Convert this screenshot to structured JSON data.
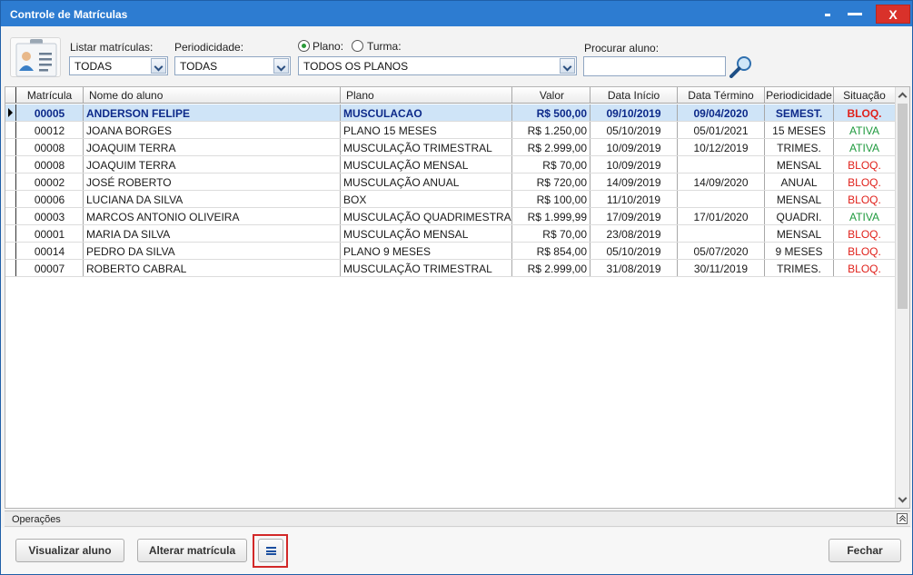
{
  "window": {
    "title": "Controle de Matrículas",
    "close_label": "X"
  },
  "filters": {
    "listar_label": "Listar matrículas:",
    "listar_value": "TODAS",
    "periodicidade_label": "Periodicidade:",
    "periodicidade_value": "TODAS",
    "radio_plano_label": "Plano:",
    "radio_turma_label": "Turma:",
    "radio_selected": "Plano",
    "plano_value": "TODOS OS PLANOS",
    "procurar_label": "Procurar aluno:",
    "procurar_value": ""
  },
  "grid": {
    "columns": [
      "Matrícula",
      "Nome do aluno",
      "Plano",
      "Valor",
      "Data Início",
      "Data Término",
      "Periodicidade",
      "Situação"
    ],
    "rows": [
      {
        "mat": "00005",
        "nome": "ANDERSON FELIPE",
        "plano": "MUSCULACAO",
        "valor": "R$ 500,00",
        "inicio": "09/10/2019",
        "termino": "09/04/2020",
        "per": "SEMEST.",
        "sit": "BLOQ."
      },
      {
        "mat": "00012",
        "nome": "JOANA BORGES",
        "plano": "PLANO 15 MESES",
        "valor": "R$ 1.250,00",
        "inicio": "05/10/2019",
        "termino": "05/01/2021",
        "per": "15 MESES",
        "sit": "ATIVA"
      },
      {
        "mat": "00008",
        "nome": "JOAQUIM TERRA",
        "plano": "MUSCULAÇÃO TRIMESTRAL",
        "valor": "R$ 2.999,00",
        "inicio": "10/09/2019",
        "termino": "10/12/2019",
        "per": "TRIMES.",
        "sit": "ATIVA"
      },
      {
        "mat": "00008",
        "nome": "JOAQUIM TERRA",
        "plano": "MUSCULAÇÃO MENSAL",
        "valor": "R$ 70,00",
        "inicio": "10/09/2019",
        "termino": "",
        "per": "MENSAL",
        "sit": "BLOQ."
      },
      {
        "mat": "00002",
        "nome": "JOSÉ ROBERTO",
        "plano": "MUSCULAÇÃO ANUAL",
        "valor": "R$ 720,00",
        "inicio": "14/09/2019",
        "termino": "14/09/2020",
        "per": "ANUAL",
        "sit": "BLOQ."
      },
      {
        "mat": "00006",
        "nome": "LUCIANA DA SILVA",
        "plano": "BOX",
        "valor": "R$ 100,00",
        "inicio": "11/10/2019",
        "termino": "",
        "per": "MENSAL",
        "sit": "BLOQ."
      },
      {
        "mat": "00003",
        "nome": "MARCOS ANTONIO OLIVEIRA",
        "plano": "MUSCULAÇÃO QUADRIMESTRAL",
        "valor": "R$ 1.999,99",
        "inicio": "17/09/2019",
        "termino": "17/01/2020",
        "per": "QUADRI.",
        "sit": "ATIVA"
      },
      {
        "mat": "00001",
        "nome": "MARIA DA SILVA",
        "plano": "MUSCULAÇÃO MENSAL",
        "valor": "R$ 70,00",
        "inicio": "23/08/2019",
        "termino": "",
        "per": "MENSAL",
        "sit": "BLOQ."
      },
      {
        "mat": "00014",
        "nome": "PEDRO DA SILVA",
        "plano": "PLANO 9 MESES",
        "valor": "R$ 854,00",
        "inicio": "05/10/2019",
        "termino": "05/07/2020",
        "per": "9 MESES",
        "sit": "BLOQ."
      },
      {
        "mat": "00007",
        "nome": "ROBERTO CABRAL",
        "plano": "MUSCULAÇÃO TRIMESTRAL",
        "valor": "R$ 2.999,00",
        "inicio": "31/08/2019",
        "termino": "30/11/2019",
        "per": "TRIMES.",
        "sit": "BLOQ."
      }
    ],
    "selected_row": 0
  },
  "operations": {
    "title": "Operações",
    "visualizar_label": "Visualizar aluno",
    "alterar_label": "Alterar matrícula",
    "fechar_label": "Fechar"
  },
  "colors": {
    "titlebar": "#2d7cd1",
    "close": "#d9312a",
    "ativa": "#1f9a3e",
    "bloq": "#e0211b",
    "selected_row": "#cfe4f7",
    "highlight_frame": "#d22828"
  },
  "icons": [
    "student-card-icon",
    "search-icon",
    "menu-icon"
  ]
}
